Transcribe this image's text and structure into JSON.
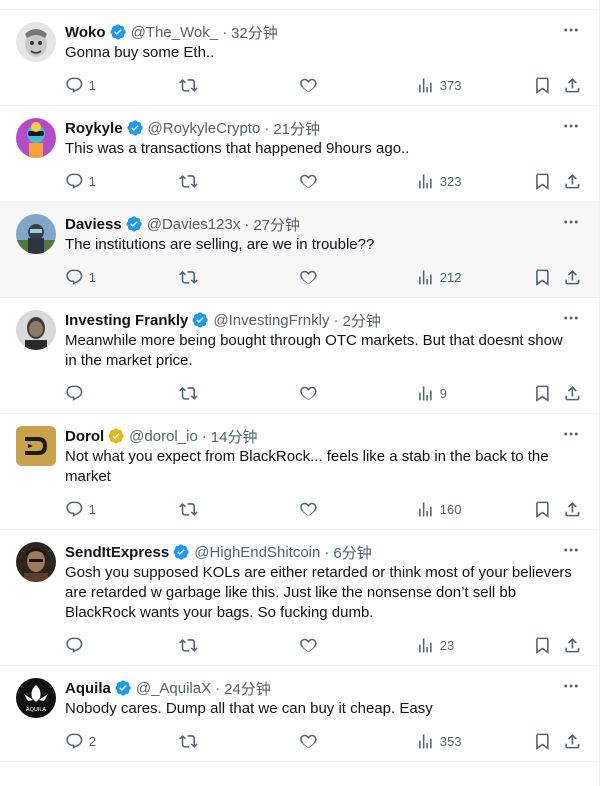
{
  "tweets": [
    {
      "name": "Woko",
      "handle": "@The_Wok_",
      "time": "32分钟",
      "text": "Gonna buy some Eth..",
      "replies": "1",
      "views": "373",
      "badge": "#1d9bf0",
      "highlight": false
    },
    {
      "name": "Roykyle",
      "handle": "@RoykyleCrypto",
      "time": "21分钟",
      "text": "This was a transactions that happened 9hours ago..",
      "replies": "1",
      "views": "323",
      "badge": "#1d9bf0",
      "highlight": false
    },
    {
      "name": "Daviess",
      "handle": "@Davies123x",
      "time": "27分钟",
      "text": "The institutions are selling, are we in trouble??",
      "replies": "1",
      "views": "212",
      "badge": "#1d9bf0",
      "highlight": true
    },
    {
      "name": "Investing Frankly",
      "handle": "@InvestingFrnkly",
      "time": "2分钟",
      "text": "Meanwhile more being bought through OTC markets. But that doesnt show in the market price.",
      "replies": "",
      "views": "9",
      "badge": "#1d9bf0",
      "highlight": false
    },
    {
      "name": "Dorol",
      "handle": "@dorol_io",
      "time": "14分钟",
      "text": "Not what you expect from BlackRock... feels like a stab in the back to the market",
      "replies": "1",
      "views": "160",
      "badge": "#e2b719",
      "highlight": false
    },
    {
      "name": "SendItExpress",
      "handle": "@HighEndShitcoin",
      "time": "6分钟",
      "text": "Gosh you supposed KOLs are either retarded or think most of your believers are retarded w garbage like this. Just like the nonsense don’t sell bb BlackRock wants your bags. So fucking dumb.",
      "replies": "",
      "views": "23",
      "badge": "#1d9bf0",
      "highlight": false
    },
    {
      "name": "Aquila",
      "handle": "@_AquilaX",
      "time": "24分钟",
      "text": "Nobody cares. Dump all that we can buy it cheap. Easy",
      "replies": "2",
      "views": "353",
      "badge": "#1d9bf0",
      "highlight": false,
      "avatar_text": "AQUILA"
    }
  ]
}
